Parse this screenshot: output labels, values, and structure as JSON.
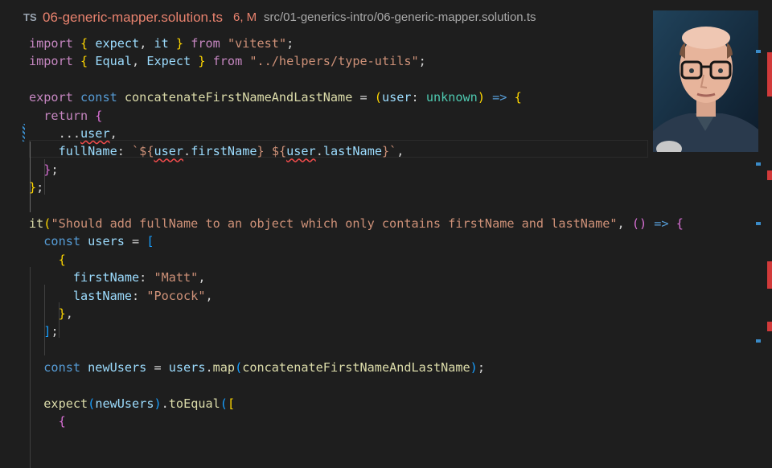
{
  "tab": {
    "lang_badge": "TS",
    "filename": "06-generic-mapper.solution.ts",
    "status": "6, M",
    "path": "src/01-generics-intro/06-generic-mapper.solution.ts"
  },
  "lines": [
    {
      "tokens": [
        {
          "t": "import ",
          "c": "ctl"
        },
        {
          "t": "{ ",
          "c": "br1"
        },
        {
          "t": "expect",
          "c": "var"
        },
        {
          "t": ", ",
          "c": "pn"
        },
        {
          "t": "it",
          "c": "var"
        },
        {
          "t": " } ",
          "c": "br1"
        },
        {
          "t": "from ",
          "c": "ctl"
        },
        {
          "t": "\"vitest\"",
          "c": "str"
        },
        {
          "t": ";",
          "c": "pn"
        }
      ]
    },
    {
      "tokens": [
        {
          "t": "import ",
          "c": "ctl"
        },
        {
          "t": "{ ",
          "c": "br1"
        },
        {
          "t": "Equal",
          "c": "var"
        },
        {
          "t": ", ",
          "c": "pn"
        },
        {
          "t": "Expect",
          "c": "var"
        },
        {
          "t": " } ",
          "c": "br1"
        },
        {
          "t": "from ",
          "c": "ctl"
        },
        {
          "t": "\"../helpers/type-utils\"",
          "c": "str"
        },
        {
          "t": ";",
          "c": "pn"
        }
      ]
    },
    {
      "tokens": []
    },
    {
      "tokens": [
        {
          "t": "export ",
          "c": "ctl"
        },
        {
          "t": "const ",
          "c": "kw"
        },
        {
          "t": "concatenateFirstNameAndLastName",
          "c": "fn"
        },
        {
          "t": " = ",
          "c": "pn"
        },
        {
          "t": "(",
          "c": "br1"
        },
        {
          "t": "user",
          "c": "var"
        },
        {
          "t": ": ",
          "c": "pn"
        },
        {
          "t": "unknown",
          "c": "ty"
        },
        {
          "t": ")",
          "c": "br1"
        },
        {
          "t": " => ",
          "c": "kw"
        },
        {
          "t": "{",
          "c": "br1"
        }
      ]
    },
    {
      "tokens": [
        {
          "t": "  return ",
          "c": "ctl"
        },
        {
          "t": "{",
          "c": "br2"
        }
      ]
    },
    {
      "tokens": [
        {
          "t": "    ...",
          "c": "pn"
        },
        {
          "t": "user",
          "c": "var",
          "sq": true
        },
        {
          "t": ",",
          "c": "pn"
        }
      ]
    },
    {
      "tokens": [
        {
          "t": "    fullName",
          "c": "var"
        },
        {
          "t": ": ",
          "c": "pn"
        },
        {
          "t": "`${",
          "c": "str"
        },
        {
          "t": "user",
          "c": "var",
          "sq": true
        },
        {
          "t": ".",
          "c": "pn"
        },
        {
          "t": "firstName",
          "c": "var"
        },
        {
          "t": "}",
          "c": "str"
        },
        {
          "t": " ",
          "c": "str"
        },
        {
          "t": "${",
          "c": "str"
        },
        {
          "t": "user",
          "c": "var",
          "sq": true
        },
        {
          "t": ".",
          "c": "pn"
        },
        {
          "t": "lastName",
          "c": "var"
        },
        {
          "t": "}`",
          "c": "str"
        },
        {
          "t": ",",
          "c": "pn"
        }
      ]
    },
    {
      "tokens": [
        {
          "t": "  }",
          "c": "br2"
        },
        {
          "t": ";",
          "c": "pn"
        }
      ]
    },
    {
      "tokens": [
        {
          "t": "}",
          "c": "br1"
        },
        {
          "t": ";",
          "c": "pn"
        }
      ]
    },
    {
      "tokens": []
    },
    {
      "tokens": [
        {
          "t": "it",
          "c": "fn"
        },
        {
          "t": "(",
          "c": "br1"
        },
        {
          "t": "\"Should add fullName to an object which only contains firstName and lastName\"",
          "c": "str"
        },
        {
          "t": ", ",
          "c": "pn"
        },
        {
          "t": "()",
          "c": "br2"
        },
        {
          "t": " => ",
          "c": "kw"
        },
        {
          "t": "{",
          "c": "br2"
        }
      ]
    },
    {
      "tokens": [
        {
          "t": "  const ",
          "c": "kw"
        },
        {
          "t": "users",
          "c": "var"
        },
        {
          "t": " = ",
          "c": "pn"
        },
        {
          "t": "[",
          "c": "br3"
        }
      ]
    },
    {
      "tokens": [
        {
          "t": "    {",
          "c": "br1"
        }
      ]
    },
    {
      "tokens": [
        {
          "t": "      firstName",
          "c": "var"
        },
        {
          "t": ": ",
          "c": "pn"
        },
        {
          "t": "\"Matt\"",
          "c": "str"
        },
        {
          "t": ",",
          "c": "pn"
        }
      ]
    },
    {
      "tokens": [
        {
          "t": "      lastName",
          "c": "var"
        },
        {
          "t": ": ",
          "c": "pn"
        },
        {
          "t": "\"Pocock\"",
          "c": "str"
        },
        {
          "t": ",",
          "c": "pn"
        }
      ]
    },
    {
      "tokens": [
        {
          "t": "    }",
          "c": "br1"
        },
        {
          "t": ",",
          "c": "pn"
        }
      ]
    },
    {
      "tokens": [
        {
          "t": "  ]",
          "c": "br3"
        },
        {
          "t": ";",
          "c": "pn"
        }
      ]
    },
    {
      "tokens": []
    },
    {
      "tokens": [
        {
          "t": "  const ",
          "c": "kw"
        },
        {
          "t": "newUsers",
          "c": "var"
        },
        {
          "t": " = ",
          "c": "pn"
        },
        {
          "t": "users",
          "c": "var"
        },
        {
          "t": ".",
          "c": "pn"
        },
        {
          "t": "map",
          "c": "fn"
        },
        {
          "t": "(",
          "c": "br3"
        },
        {
          "t": "concatenateFirstNameAndLastName",
          "c": "fn"
        },
        {
          "t": ")",
          "c": "br3"
        },
        {
          "t": ";",
          "c": "pn"
        }
      ]
    },
    {
      "tokens": []
    },
    {
      "tokens": [
        {
          "t": "  expect",
          "c": "fn"
        },
        {
          "t": "(",
          "c": "br3"
        },
        {
          "t": "newUsers",
          "c": "var"
        },
        {
          "t": ")",
          "c": "br3"
        },
        {
          "t": ".",
          "c": "pn"
        },
        {
          "t": "toEqual",
          "c": "fn"
        },
        {
          "t": "(",
          "c": "br3"
        },
        {
          "t": "[",
          "c": "br1"
        }
      ]
    },
    {
      "tokens": [
        {
          "t": "    {",
          "c": "br2"
        }
      ]
    }
  ],
  "colors": {
    "background": "#1e1e1e",
    "error": "#f14c4c",
    "modified": "#3a8bc8"
  }
}
